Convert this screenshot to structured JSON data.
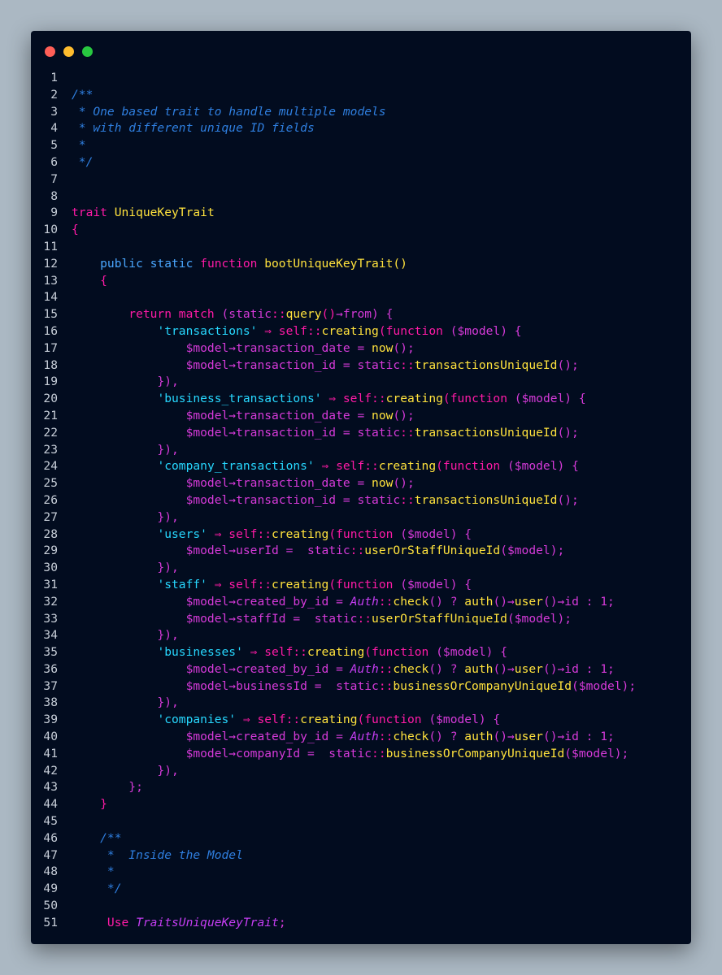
{
  "window": {
    "controls": [
      {
        "name": "close",
        "color": "#ff5f57"
      },
      {
        "name": "minimize",
        "color": "#ffbd2e"
      },
      {
        "name": "maximize",
        "color": "#28c840"
      }
    ]
  },
  "colors": {
    "background": "#abb8c3",
    "editor": "#020c1f",
    "comment": "#2f7fe0",
    "keyword": "#ff1aa6",
    "string": "#27d8ff",
    "function": "#ffe23d",
    "plain": "#d63ad9",
    "class": "#c53df2"
  },
  "lines": [
    {
      "n": "1",
      "tokens": []
    },
    {
      "n": "2",
      "tokens": [
        {
          "t": "/**",
          "c": "comment"
        }
      ]
    },
    {
      "n": "3",
      "tokens": [
        {
          "t": " * One based trait to handle multiple models",
          "c": "comment"
        }
      ]
    },
    {
      "n": "4",
      "tokens": [
        {
          "t": " * with different unique ID fields",
          "c": "comment"
        }
      ]
    },
    {
      "n": "5",
      "tokens": [
        {
          "t": " *",
          "c": "comment"
        }
      ]
    },
    {
      "n": "6",
      "tokens": [
        {
          "t": " */",
          "c": "comment"
        }
      ]
    },
    {
      "n": "7",
      "tokens": []
    },
    {
      "n": "8",
      "tokens": []
    },
    {
      "n": "9",
      "tokens": [
        {
          "t": "trait ",
          "c": "keyword"
        },
        {
          "t": "UniqueKeyTrait",
          "c": "type"
        }
      ]
    },
    {
      "n": "10",
      "tokens": [
        {
          "t": "{",
          "c": "punct"
        }
      ]
    },
    {
      "n": "11",
      "tokens": []
    },
    {
      "n": "12",
      "tokens": [
        {
          "t": "    public static ",
          "c": "blue"
        },
        {
          "t": "function ",
          "c": "keyword"
        },
        {
          "t": "bootUniqueKeyTrait",
          "c": "function"
        },
        {
          "t": "()",
          "c": "type"
        }
      ]
    },
    {
      "n": "13",
      "tokens": [
        {
          "t": "    {",
          "c": "punct"
        }
      ]
    },
    {
      "n": "14",
      "tokens": []
    },
    {
      "n": "15",
      "tokens": [
        {
          "t": "        return match ",
          "c": "keyword"
        },
        {
          "t": "(static",
          "c": "plain"
        },
        {
          "t": "::",
          "c": "punct"
        },
        {
          "t": "query",
          "c": "function"
        },
        {
          "t": "()",
          "c": "punct"
        },
        {
          "t": "→from) {",
          "c": "plain"
        }
      ]
    },
    {
      "n": "16",
      "tokens": [
        {
          "t": "            ",
          "c": "plain"
        },
        {
          "t": "'transactions'",
          "c": "string"
        },
        {
          "t": " ⇒ self",
          "c": "keyword"
        },
        {
          "t": "::",
          "c": "punct"
        },
        {
          "t": "creating",
          "c": "function"
        },
        {
          "t": "(function ",
          "c": "keyword"
        },
        {
          "t": "($model) {",
          "c": "plain"
        }
      ]
    },
    {
      "n": "17",
      "tokens": [
        {
          "t": "                $model→transaction_date = ",
          "c": "plain"
        },
        {
          "t": "now",
          "c": "function"
        },
        {
          "t": "();",
          "c": "plain"
        }
      ]
    },
    {
      "n": "18",
      "tokens": [
        {
          "t": "                $model→transaction_id = static",
          "c": "plain"
        },
        {
          "t": "::",
          "c": "punct"
        },
        {
          "t": "transactionsUniqueId",
          "c": "function"
        },
        {
          "t": "();",
          "c": "plain"
        }
      ]
    },
    {
      "n": "19",
      "tokens": [
        {
          "t": "            }),",
          "c": "plain"
        }
      ]
    },
    {
      "n": "20",
      "tokens": [
        {
          "t": "            ",
          "c": "plain"
        },
        {
          "t": "'business_transactions'",
          "c": "string"
        },
        {
          "t": " ⇒ self",
          "c": "keyword"
        },
        {
          "t": "::",
          "c": "punct"
        },
        {
          "t": "creating",
          "c": "function"
        },
        {
          "t": "(function ",
          "c": "keyword"
        },
        {
          "t": "($model) {",
          "c": "plain"
        }
      ]
    },
    {
      "n": "21",
      "tokens": [
        {
          "t": "                $model→transaction_date = ",
          "c": "plain"
        },
        {
          "t": "now",
          "c": "function"
        },
        {
          "t": "();",
          "c": "plain"
        }
      ]
    },
    {
      "n": "22",
      "tokens": [
        {
          "t": "                $model→transaction_id = static",
          "c": "plain"
        },
        {
          "t": "::",
          "c": "punct"
        },
        {
          "t": "transactionsUniqueId",
          "c": "function"
        },
        {
          "t": "();",
          "c": "plain"
        }
      ]
    },
    {
      "n": "23",
      "tokens": [
        {
          "t": "            }),",
          "c": "plain"
        }
      ]
    },
    {
      "n": "24",
      "tokens": [
        {
          "t": "            ",
          "c": "plain"
        },
        {
          "t": "'company_transactions'",
          "c": "string"
        },
        {
          "t": " ⇒ self",
          "c": "keyword"
        },
        {
          "t": "::",
          "c": "punct"
        },
        {
          "t": "creating",
          "c": "function"
        },
        {
          "t": "(function ",
          "c": "keyword"
        },
        {
          "t": "($model) {",
          "c": "plain"
        }
      ]
    },
    {
      "n": "25",
      "tokens": [
        {
          "t": "                $model→transaction_date = ",
          "c": "plain"
        },
        {
          "t": "now",
          "c": "function"
        },
        {
          "t": "();",
          "c": "plain"
        }
      ]
    },
    {
      "n": "26",
      "tokens": [
        {
          "t": "                $model→transaction_id = static",
          "c": "plain"
        },
        {
          "t": "::",
          "c": "punct"
        },
        {
          "t": "transactionsUniqueId",
          "c": "function"
        },
        {
          "t": "();",
          "c": "plain"
        }
      ]
    },
    {
      "n": "27",
      "tokens": [
        {
          "t": "            }),",
          "c": "plain"
        }
      ]
    },
    {
      "n": "28",
      "tokens": [
        {
          "t": "            ",
          "c": "plain"
        },
        {
          "t": "'users'",
          "c": "string"
        },
        {
          "t": " ⇒ self",
          "c": "keyword"
        },
        {
          "t": "::",
          "c": "punct"
        },
        {
          "t": "creating",
          "c": "function"
        },
        {
          "t": "(function ",
          "c": "keyword"
        },
        {
          "t": "($model) {",
          "c": "plain"
        }
      ]
    },
    {
      "n": "29",
      "tokens": [
        {
          "t": "                $model→userId =  static",
          "c": "plain"
        },
        {
          "t": "::",
          "c": "punct"
        },
        {
          "t": "userOrStaffUniqueId",
          "c": "function"
        },
        {
          "t": "($model);",
          "c": "plain"
        }
      ]
    },
    {
      "n": "30",
      "tokens": [
        {
          "t": "            }),",
          "c": "plain"
        }
      ]
    },
    {
      "n": "31",
      "tokens": [
        {
          "t": "            ",
          "c": "plain"
        },
        {
          "t": "'staff'",
          "c": "string"
        },
        {
          "t": " ⇒ self",
          "c": "keyword"
        },
        {
          "t": "::",
          "c": "punct"
        },
        {
          "t": "creating",
          "c": "function"
        },
        {
          "t": "(function ",
          "c": "keyword"
        },
        {
          "t": "($model) {",
          "c": "plain"
        }
      ]
    },
    {
      "n": "32",
      "tokens": [
        {
          "t": "                $model→created_by_id = ",
          "c": "plain"
        },
        {
          "t": "Auth",
          "c": "class"
        },
        {
          "t": "::",
          "c": "punct"
        },
        {
          "t": "check",
          "c": "function"
        },
        {
          "t": "() ? ",
          "c": "plain"
        },
        {
          "t": "auth",
          "c": "function"
        },
        {
          "t": "()→",
          "c": "plain"
        },
        {
          "t": "user",
          "c": "function"
        },
        {
          "t": "()→id : 1;",
          "c": "plain"
        }
      ]
    },
    {
      "n": "33",
      "tokens": [
        {
          "t": "                $model→staffId =  static",
          "c": "plain"
        },
        {
          "t": "::",
          "c": "punct"
        },
        {
          "t": "userOrStaffUniqueId",
          "c": "function"
        },
        {
          "t": "($model);",
          "c": "plain"
        }
      ]
    },
    {
      "n": "34",
      "tokens": [
        {
          "t": "            }),",
          "c": "plain"
        }
      ]
    },
    {
      "n": "35",
      "tokens": [
        {
          "t": "            ",
          "c": "plain"
        },
        {
          "t": "'businesses'",
          "c": "string"
        },
        {
          "t": " ⇒ self",
          "c": "keyword"
        },
        {
          "t": "::",
          "c": "punct"
        },
        {
          "t": "creating",
          "c": "function"
        },
        {
          "t": "(function ",
          "c": "keyword"
        },
        {
          "t": "($model) {",
          "c": "plain"
        }
      ]
    },
    {
      "n": "36",
      "tokens": [
        {
          "t": "                $model→created_by_id = ",
          "c": "plain"
        },
        {
          "t": "Auth",
          "c": "class"
        },
        {
          "t": "::",
          "c": "punct"
        },
        {
          "t": "check",
          "c": "function"
        },
        {
          "t": "() ? ",
          "c": "plain"
        },
        {
          "t": "auth",
          "c": "function"
        },
        {
          "t": "()→",
          "c": "plain"
        },
        {
          "t": "user",
          "c": "function"
        },
        {
          "t": "()→id : 1;",
          "c": "plain"
        }
      ]
    },
    {
      "n": "37",
      "tokens": [
        {
          "t": "                $model→businessId =  static",
          "c": "plain"
        },
        {
          "t": "::",
          "c": "punct"
        },
        {
          "t": "businessOrCompanyUniqueId",
          "c": "function"
        },
        {
          "t": "($model);",
          "c": "plain"
        }
      ]
    },
    {
      "n": "38",
      "tokens": [
        {
          "t": "            }),",
          "c": "plain"
        }
      ]
    },
    {
      "n": "39",
      "tokens": [
        {
          "t": "            ",
          "c": "plain"
        },
        {
          "t": "'companies'",
          "c": "string"
        },
        {
          "t": " ⇒ self",
          "c": "keyword"
        },
        {
          "t": "::",
          "c": "punct"
        },
        {
          "t": "creating",
          "c": "function"
        },
        {
          "t": "(function ",
          "c": "keyword"
        },
        {
          "t": "($model) {",
          "c": "plain"
        }
      ]
    },
    {
      "n": "40",
      "tokens": [
        {
          "t": "                $model→created_by_id = ",
          "c": "plain"
        },
        {
          "t": "Auth",
          "c": "class"
        },
        {
          "t": "::",
          "c": "punct"
        },
        {
          "t": "check",
          "c": "function"
        },
        {
          "t": "() ? ",
          "c": "plain"
        },
        {
          "t": "auth",
          "c": "function"
        },
        {
          "t": "()→",
          "c": "plain"
        },
        {
          "t": "user",
          "c": "function"
        },
        {
          "t": "()→id : 1;",
          "c": "plain"
        }
      ]
    },
    {
      "n": "41",
      "tokens": [
        {
          "t": "                $model→companyId =  static",
          "c": "plain"
        },
        {
          "t": "::",
          "c": "punct"
        },
        {
          "t": "businessOrCompanyUniqueId",
          "c": "function"
        },
        {
          "t": "($model);",
          "c": "plain"
        }
      ]
    },
    {
      "n": "42",
      "tokens": [
        {
          "t": "            }),",
          "c": "plain"
        }
      ]
    },
    {
      "n": "43",
      "tokens": [
        {
          "t": "        };",
          "c": "plain"
        }
      ]
    },
    {
      "n": "44",
      "tokens": [
        {
          "t": "    }",
          "c": "punct"
        }
      ]
    },
    {
      "n": "45",
      "tokens": []
    },
    {
      "n": "46",
      "tokens": [
        {
          "t": "    /**",
          "c": "comment"
        }
      ]
    },
    {
      "n": "47",
      "tokens": [
        {
          "t": "     *  Inside the Model",
          "c": "comment"
        }
      ]
    },
    {
      "n": "48",
      "tokens": [
        {
          "t": "     *",
          "c": "comment"
        }
      ]
    },
    {
      "n": "49",
      "tokens": [
        {
          "t": "     */",
          "c": "comment"
        }
      ]
    },
    {
      "n": "50",
      "tokens": []
    },
    {
      "n": "51",
      "tokens": [
        {
          "t": "     Use ",
          "c": "keyword"
        },
        {
          "t": "TraitsUniqueKeyTrait",
          "c": "class"
        },
        {
          "t": ";",
          "c": "plain"
        }
      ]
    }
  ]
}
